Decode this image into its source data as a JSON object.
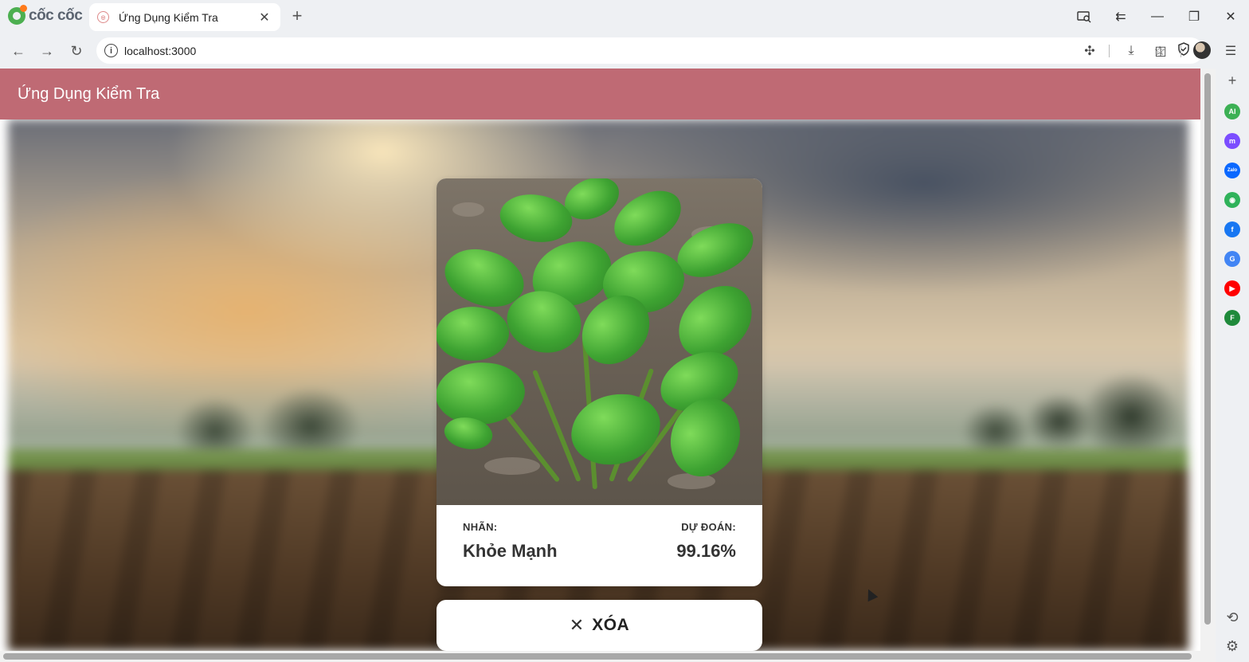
{
  "browser": {
    "brand": "cốc cốc",
    "tab": {
      "title": "Ứng Dụng Kiểm Tra"
    },
    "url": "localhost:3000"
  },
  "app": {
    "header_title": "Ứng Dụng Kiểm Tra",
    "result": {
      "label_caption": "NHÃN:",
      "label_value": "Khỏe Mạnh",
      "prediction_caption": "DỰ ĐOÁN:",
      "prediction_value": "99.16%"
    },
    "clear_button_label": "XÓA"
  },
  "sidebar": {
    "items": [
      {
        "name": "ai-icon",
        "text": "AI",
        "color": "#3cb054"
      },
      {
        "name": "messenger-icon",
        "text": "m",
        "color": "#7b4dff"
      },
      {
        "name": "zalo-icon",
        "text": "Zalo",
        "color": "#0a68ff"
      },
      {
        "name": "game-icon",
        "text": "◉",
        "color": "#2fb25a"
      },
      {
        "name": "facebook-icon",
        "text": "f",
        "color": "#1877f2"
      },
      {
        "name": "translate-icon",
        "text": "G",
        "color": "#4285f4"
      },
      {
        "name": "youtube-icon",
        "text": "▶",
        "color": "#ff0000"
      },
      {
        "name": "feed-icon",
        "text": "F",
        "color": "#1f8a3b"
      }
    ]
  },
  "colors": {
    "header": "#bf6a74",
    "card": "#ffffff"
  }
}
